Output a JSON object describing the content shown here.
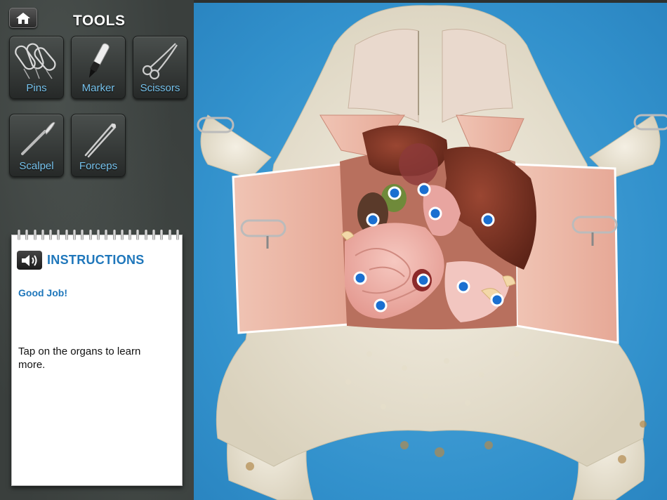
{
  "header": {
    "tools_title": "TOOLS",
    "home_icon": "home-icon"
  },
  "tools": [
    {
      "id": "pins",
      "label": "Pins",
      "icon": "pins-icon"
    },
    {
      "id": "marker",
      "label": "Marker",
      "icon": "marker-icon"
    },
    {
      "id": "scissors",
      "label": "Scissors",
      "icon": "scissors-icon"
    },
    {
      "id": "scalpel",
      "label": "Scalpel",
      "icon": "scalpel-icon"
    },
    {
      "id": "forceps",
      "label": "Forceps",
      "icon": "forceps-icon"
    }
  ],
  "instructions": {
    "title": "INSTRUCTIONS",
    "status": "Good Job!",
    "body": "Tap on the organs to learn more.",
    "speaker_icon": "speaker-icon"
  },
  "colors": {
    "accent_blue": "#1f77bb",
    "tool_label": "#78c4ee",
    "background_blue": "#3291cc",
    "organ_marker": "#1a6fd0"
  }
}
